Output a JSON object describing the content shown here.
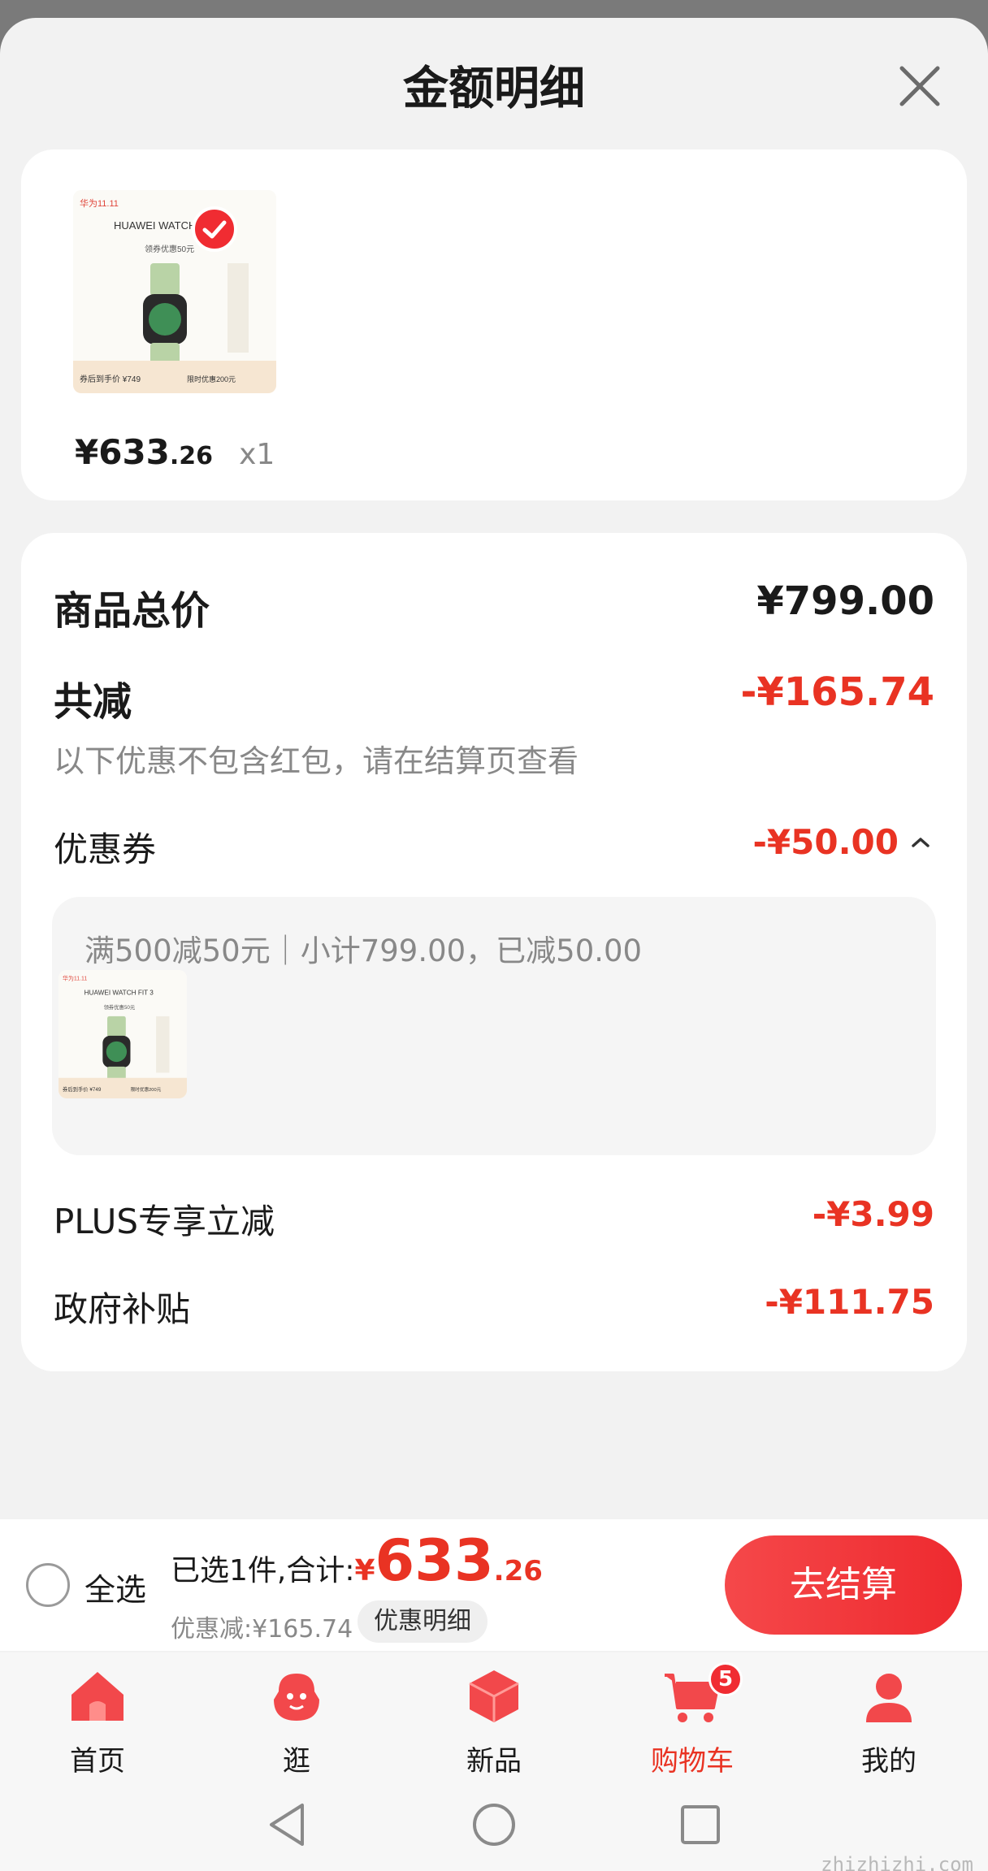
{
  "header": {
    "title": "金额明细"
  },
  "product": {
    "price_int": "¥633",
    "price_dec": ".26",
    "quantity": "x1",
    "image": {
      "promo_tag": "华为11.11",
      "model": "HUAWEI WATCH FIT 3",
      "coupon_tag": "领券优惠50元",
      "final_price_label": "券后到手价 ¥749",
      "limited_label": "限时优惠200元"
    },
    "selected": true
  },
  "details": {
    "total_label": "商品总价",
    "total_value": "¥799.00",
    "reduce_label": "共减",
    "reduce_value": "-¥165.74",
    "reduce_note": "以下优惠不包含红包，请在结算页查看",
    "coupon_label": "优惠券",
    "coupon_value": "-¥50.00",
    "coupon_rule": "满500减50元｜小计799.00，已减50.00",
    "plus_label": "PLUS专享立减",
    "plus_value": "-¥3.99",
    "gov_label": "政府补贴",
    "gov_value": "-¥111.75"
  },
  "checkout": {
    "select_all": "全选",
    "summary_label": "已选1件,合计:",
    "summary_yen": "¥",
    "summary_int": "633",
    "summary_dec": ".26",
    "discount_text": "优惠减:¥165.74",
    "detail_button": "优惠明细",
    "checkout_button": "去结算"
  },
  "tabbar": {
    "items": [
      {
        "label": "首页",
        "icon": "home-icon"
      },
      {
        "label": "逛",
        "icon": "browse-icon"
      },
      {
        "label": "新品",
        "icon": "new-product-icon"
      },
      {
        "label": "购物车",
        "icon": "cart-icon",
        "badge": "5",
        "active": true
      },
      {
        "label": "我的",
        "icon": "profile-icon"
      }
    ]
  },
  "watermark": "zhizhizhi.com",
  "colors": {
    "accent": "#e93323",
    "background": "#f2f2f2"
  }
}
